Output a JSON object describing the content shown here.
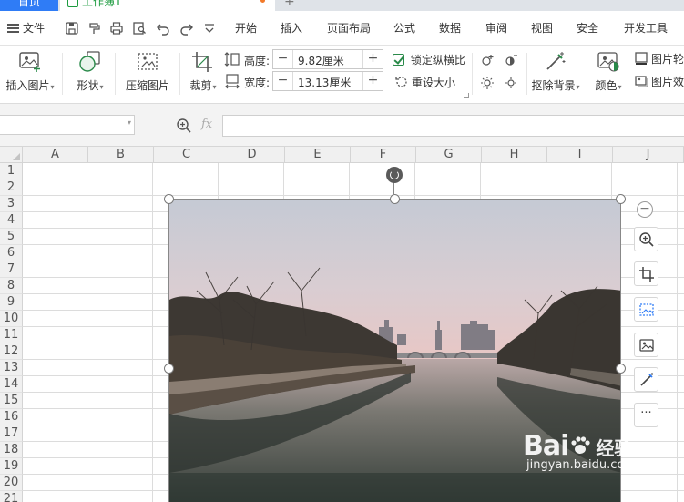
{
  "tabs": {
    "home": "首页",
    "workbook": "工作簿1",
    "new_tab": "+"
  },
  "menu": {
    "file": "文件",
    "items": [
      "开始",
      "插入",
      "页面布局",
      "公式",
      "数据",
      "审阅",
      "视图",
      "安全",
      "开发工具"
    ]
  },
  "ribbon": {
    "insert_picture": "插入图片",
    "shape": "形状",
    "compress_picture": "压缩图片",
    "crop": "裁剪",
    "height_label": "高度:",
    "height_value": "9.82厘米",
    "width_label": "宽度:",
    "width_value": "13.13厘米",
    "lock_aspect": "锁定纵横比",
    "reset_size": "重设大小",
    "remove_background": "抠除背景",
    "color": "颜色",
    "picture_outline": "图片轮",
    "picture_effects": "图片效"
  },
  "formula_bar": {
    "fx": "fx",
    "name_box": "",
    "formula": ""
  },
  "columns": [
    "A",
    "B",
    "C",
    "D",
    "E",
    "F",
    "G",
    "H",
    "I",
    "J"
  ],
  "rows": [
    "1",
    "2",
    "3",
    "4",
    "5",
    "6",
    "7",
    "8",
    "9",
    "10",
    "11",
    "12",
    "13",
    "14",
    "15",
    "16",
    "17",
    "18",
    "19",
    "20",
    "21"
  ],
  "float_toolbar": {
    "more": "···"
  },
  "watermark": {
    "brand": "Bai",
    "brand2": "经验",
    "url": "jingyan.baidu.com"
  },
  "colors": {
    "tab_active": "#2f7cf6",
    "workbook_green": "#1c9b3f",
    "checkbox_green": "#2a8a4a",
    "sky_top": "#c9ced8",
    "sky_horizon": "#e7c9c9",
    "water": "#3f4a44"
  },
  "icons": {
    "quick_access": [
      "save-icon",
      "format-painter-icon",
      "print-icon",
      "print-preview-icon",
      "undo-icon",
      "redo-icon",
      "more-down-icon"
    ],
    "floating": [
      "zoom-in-icon",
      "crop-icon",
      "compress-icon",
      "replace-picture-icon",
      "remove-bg-icon"
    ]
  }
}
